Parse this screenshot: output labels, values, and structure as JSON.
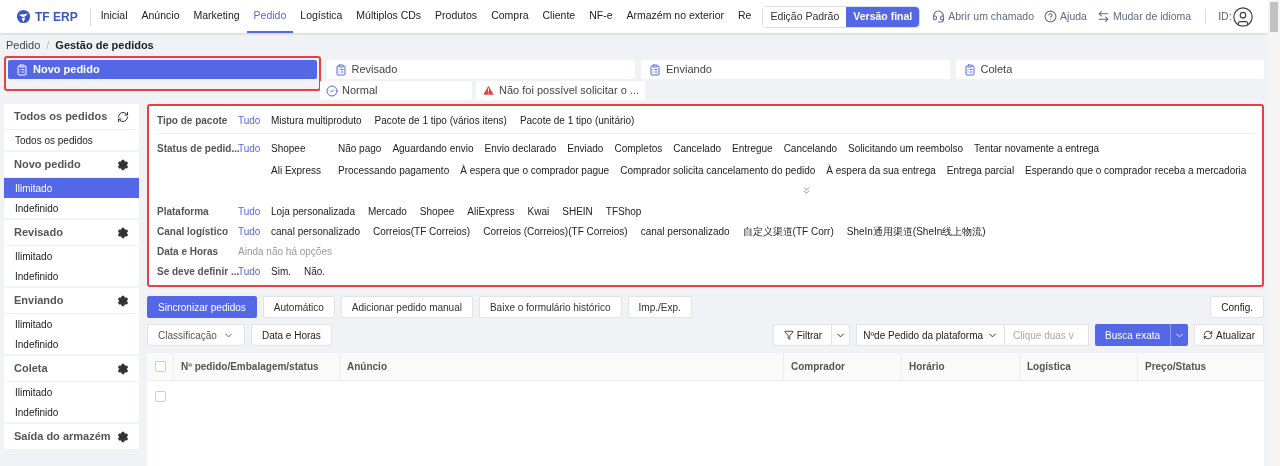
{
  "nav": {
    "logo": "TF ERP",
    "items": [
      {
        "label": "Inicial",
        "selected": false
      },
      {
        "label": "Anúncio",
        "selected": false
      },
      {
        "label": "Marketing",
        "selected": false
      },
      {
        "label": "Pedido",
        "selected": true
      },
      {
        "label": "Logística",
        "selected": false
      },
      {
        "label": "Múltiplos CDs",
        "selected": false
      },
      {
        "label": "Produtos",
        "selected": false
      },
      {
        "label": "Compra",
        "selected": false
      },
      {
        "label": "Cliente",
        "selected": false
      },
      {
        "label": "NF-e",
        "selected": false
      },
      {
        "label": "Armazém no exterior",
        "selected": false
      },
      {
        "label": "Re",
        "selected": false
      }
    ],
    "editions": [
      {
        "label": "Edição Padrão",
        "selected": false
      },
      {
        "label": "Versão final",
        "selected": true
      }
    ],
    "links": [
      {
        "kind": "support",
        "label": "Abrir um chamado"
      },
      {
        "kind": "help",
        "label": "Ajuda"
      },
      {
        "kind": "language",
        "label": "Mudar de idioma"
      }
    ],
    "id_label": "ID:"
  },
  "breadcrumb": {
    "items": [
      "Pedido",
      "Gestão de pedidos"
    ],
    "separator": "/"
  },
  "steps": [
    {
      "label": "Novo pedido",
      "selected": true,
      "highlighted": true
    },
    {
      "label": "Revisado",
      "selected": false,
      "highlighted": false
    },
    {
      "label": "Enviando",
      "selected": false,
      "highlighted": false
    },
    {
      "label": "Coleta",
      "selected": false,
      "highlighted": false
    }
  ],
  "substeps": [
    {
      "kind": "ok",
      "label": "Normal"
    },
    {
      "kind": "warning",
      "label": "Não foi possível solicitar o ..."
    }
  ],
  "sidebar": [
    {
      "title": "Todos os pedidos",
      "kind": "refresh",
      "items": [
        {
          "label": "Todos os pedidos",
          "selected": false
        }
      ]
    },
    {
      "title": "Novo pedido",
      "kind": "settings",
      "items": [
        {
          "label": "Ilimitado",
          "selected": true
        },
        {
          "label": "Indefinido",
          "selected": false
        }
      ]
    },
    {
      "title": "Revisado",
      "kind": "settings",
      "items": [
        {
          "label": "Ilimitado",
          "selected": false
        },
        {
          "label": "Indefinido",
          "selected": false
        }
      ]
    },
    {
      "title": "Enviando",
      "kind": "settings",
      "items": [
        {
          "label": "Ilimitado",
          "selected": false
        },
        {
          "label": "Indefinido",
          "selected": false
        }
      ]
    },
    {
      "title": "Coleta",
      "kind": "settings",
      "items": [
        {
          "label": "Ilimitado",
          "selected": false
        },
        {
          "label": "Indefinido",
          "selected": false
        }
      ]
    },
    {
      "title": "Saída do armazém",
      "kind": "settings"
    }
  ],
  "filters": {
    "highlighted": true,
    "rows": [
      {
        "kind": "options",
        "label": "Tipo de pacote",
        "all": "Tudo",
        "options": [
          "Mistura multiproduto",
          "Pacote de 1 tipo (vários itens)",
          "Pacote de 1 tipo (unitário)"
        ]
      },
      {
        "kind": "grouped",
        "label": "Status de pedid...",
        "all": "Tudo",
        "groups": [
          {
            "platform": "Shopee",
            "options": [
              "Não pago",
              "Aguardando envio",
              "Envio declarado",
              "Enviado",
              "Completos",
              "Cancelado",
              "Entregue",
              "Cancelando",
              "Solicitando um reembolso",
              "Tentar novamente a entrega"
            ]
          },
          {
            "platform": "Ali Express",
            "options": [
              "Processando pagamento",
              "À espera que o comprador pague",
              "Comprador solicita cancelamento do pedido",
              "À espera da sua entrega",
              "Entrega parcial",
              "Esperando que o comprador receba a mercadoria"
            ]
          }
        ]
      },
      {
        "kind": "options",
        "label": "Plataforma",
        "all": "Tudo",
        "options": [
          "Loja personalizada",
          "Mercado",
          "Shopee",
          "AliExpress",
          "Kwai",
          "SHEIN",
          "TFShop"
        ]
      },
      {
        "kind": "options",
        "label": "Canal logístico",
        "all": "Tudo",
        "options": [
          "canal personalizado",
          "Correios(TF Correios)",
          "Correios (Correios)(TF Correios)",
          "canal personalizado",
          "自定义渠道(TF Corr)",
          "SheIn通用渠道(SheIn线上物流)"
        ]
      },
      {
        "kind": "empty",
        "label": "Data e Horas",
        "note": "Ainda não há opções"
      },
      {
        "kind": "options",
        "label": "Se deve definir ...",
        "all": "Tudo",
        "options": [
          "Sim.",
          "Não."
        ]
      }
    ]
  },
  "actions": [
    {
      "label": "Sincronizar pedidos",
      "primary": true
    },
    {
      "label": "Automático",
      "primary": false
    },
    {
      "label": "Adicionar pedido manual",
      "primary": false
    },
    {
      "label": "Baixe o formulário histórico",
      "primary": false
    },
    {
      "label": "Imp./Exp.",
      "primary": false
    }
  ],
  "config_button": "Config.",
  "sort_button": "Classificação",
  "date_button": "Data e Horas",
  "filter_button": "Filtrar",
  "search_field_select": "Nºde Pedido da plataforma",
  "search": {
    "placeholder": "Clique duas v"
  },
  "exact_search": "Busca exata",
  "refresh_button": "Atualizar",
  "table": {
    "select_all_checked": false,
    "rows": [
      {
        "checked": false
      }
    ],
    "columns": [
      "Nº pedido/Embalagem/status",
      "Anúncio",
      "Comprador",
      "Horário",
      "Logística",
      "Preço/Status"
    ]
  }
}
